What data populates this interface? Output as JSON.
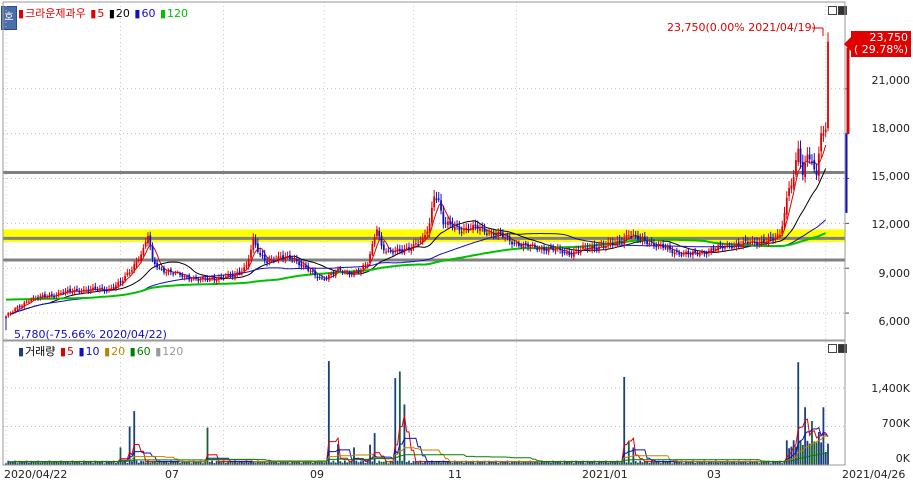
{
  "corner_button": {
    "label": "호"
  },
  "price_legend": {
    "title": "크라운제과우",
    "items": [
      {
        "label": "5",
        "color": "#e00000"
      },
      {
        "label": "20",
        "color": "#000000"
      },
      {
        "label": "60",
        "color": "#1010c0"
      },
      {
        "label": "120",
        "color": "#00c000"
      }
    ]
  },
  "volume_legend": {
    "title": "거래량",
    "items": [
      {
        "label": "5",
        "color": "#e00000"
      },
      {
        "label": "10",
        "color": "#1010c0"
      },
      {
        "label": "20",
        "color": "#c08000"
      },
      {
        "label": "60",
        "color": "#008000"
      },
      {
        "label": "120",
        "color": "#999999"
      }
    ]
  },
  "annotations": {
    "high": "23,750(0.00% 2021/04/19)",
    "low": "5,780(-75.66% 2020/04/22)"
  },
  "current_price": {
    "price": "23,750",
    "change": "( 29.78%)",
    "color": "#e00000"
  },
  "colors": {
    "up": "#e00000",
    "down": "#1010c0",
    "highlight_band": "#ffff00",
    "support_line": "#808080"
  },
  "chart_data": [
    {
      "type": "candlestick",
      "title": "크라운제과우",
      "y_ticks": [
        6000,
        9000,
        12000,
        15000,
        18000,
        21000
      ],
      "y_tick_labels": [
        "6,000",
        "9,000",
        "12,000",
        "15,000",
        "18,000",
        "21,000"
      ],
      "ylim": [
        4200,
        25600
      ],
      "x_tick_labels": [
        "2020/04/22",
        "07",
        "09",
        "11",
        "2021/01",
        "03",
        "2021/04/26"
      ],
      "highlight_band": [
        10750,
        11600
      ],
      "horizontal_lines": [
        15400,
        11000,
        9550
      ],
      "series": [
        {
          "name": "Close",
          "anchors": [
            [
              0,
              5780
            ],
            [
              10,
              6900
            ],
            [
              30,
              7500
            ],
            [
              45,
              7600
            ],
            [
              50,
              8000
            ],
            [
              55,
              9000
            ],
            [
              60,
              10200
            ],
            [
              62,
              11200
            ],
            [
              64,
              9500
            ],
            [
              67,
              9000
            ],
            [
              72,
              8700
            ],
            [
              85,
              8200
            ],
            [
              100,
              8500
            ],
            [
              105,
              9200
            ],
            [
              108,
              10800
            ],
            [
              111,
              9800
            ],
            [
              114,
              9500
            ],
            [
              120,
              9700
            ],
            [
              126,
              9600
            ],
            [
              131,
              9000
            ],
            [
              135,
              8500
            ],
            [
              138,
              8300
            ],
            [
              145,
              8800
            ],
            [
              150,
              8700
            ],
            [
              155,
              8900
            ],
            [
              158,
              9300
            ],
            [
              160,
              10500
            ],
            [
              162,
              11800
            ],
            [
              164,
              10500
            ],
            [
              167,
              10000
            ],
            [
              172,
              10200
            ],
            [
              178,
              10500
            ],
            [
              182,
              10800
            ],
            [
              185,
              12000
            ],
            [
              187,
              14000
            ],
            [
              189,
              13500
            ],
            [
              191,
              12000
            ],
            [
              195,
              11800
            ],
            [
              200,
              11600
            ],
            [
              206,
              11700
            ],
            [
              211,
              11400
            ],
            [
              216,
              11200
            ],
            [
              221,
              10800
            ],
            [
              226,
              10500
            ],
            [
              231,
              10400
            ],
            [
              236,
              10300
            ],
            [
              241,
              10200
            ],
            [
              246,
              10000
            ],
            [
              251,
              10200
            ],
            [
              256,
              10400
            ],
            [
              261,
              10500
            ],
            [
              266,
              10600
            ],
            [
              269,
              10900
            ],
            [
              272,
              11300
            ],
            [
              275,
              11000
            ],
            [
              280,
              10800
            ],
            [
              285,
              10500
            ],
            [
              290,
              10200
            ],
            [
              295,
              10000
            ],
            [
              300,
              9950
            ],
            [
              305,
              10100
            ],
            [
              310,
              10300
            ],
            [
              315,
              10500
            ],
            [
              320,
              10600
            ],
            [
              325,
              10700
            ],
            [
              330,
              10800
            ],
            [
              335,
              10900
            ],
            [
              338,
              11200
            ],
            [
              340,
              12800
            ],
            [
              342,
              14500
            ],
            [
              344,
              15000
            ],
            [
              346,
              17000
            ],
            [
              348,
              15000
            ],
            [
              350,
              16800
            ],
            [
              352,
              16000
            ],
            [
              354,
              15500
            ],
            [
              356,
              17800
            ],
            [
              358,
              18300
            ],
            [
              359,
              23750
            ]
          ]
        },
        {
          "name": "MA5",
          "color": "#e00000"
        },
        {
          "name": "MA20",
          "color": "#000000"
        },
        {
          "name": "MA60",
          "color": "#1010c0"
        },
        {
          "name": "MA120",
          "color": "#00c000"
        }
      ]
    },
    {
      "type": "bar",
      "title": "거래량",
      "y_ticks": [
        0,
        700000,
        1400000
      ],
      "y_tick_labels": [
        "0K",
        "700K",
        "1,400K"
      ],
      "ylim": [
        0,
        2000000
      ],
      "spikes": [
        [
          50,
          320000
        ],
        [
          54,
          700000
        ],
        [
          56,
          980000
        ],
        [
          88,
          680000
        ],
        [
          141,
          1890000
        ],
        [
          145,
          380000
        ],
        [
          152,
          320000
        ],
        [
          159,
          370000
        ],
        [
          161,
          580000
        ],
        [
          170,
          1580000
        ],
        [
          172,
          1700000
        ],
        [
          174,
          1100000
        ],
        [
          270,
          1600000
        ],
        [
          272,
          420000
        ],
        [
          274,
          320000
        ],
        [
          346,
          1870000
        ],
        [
          349,
          1050000
        ],
        [
          352,
          800000
        ],
        [
          355,
          600000
        ],
        [
          357,
          1050000
        ]
      ]
    }
  ]
}
